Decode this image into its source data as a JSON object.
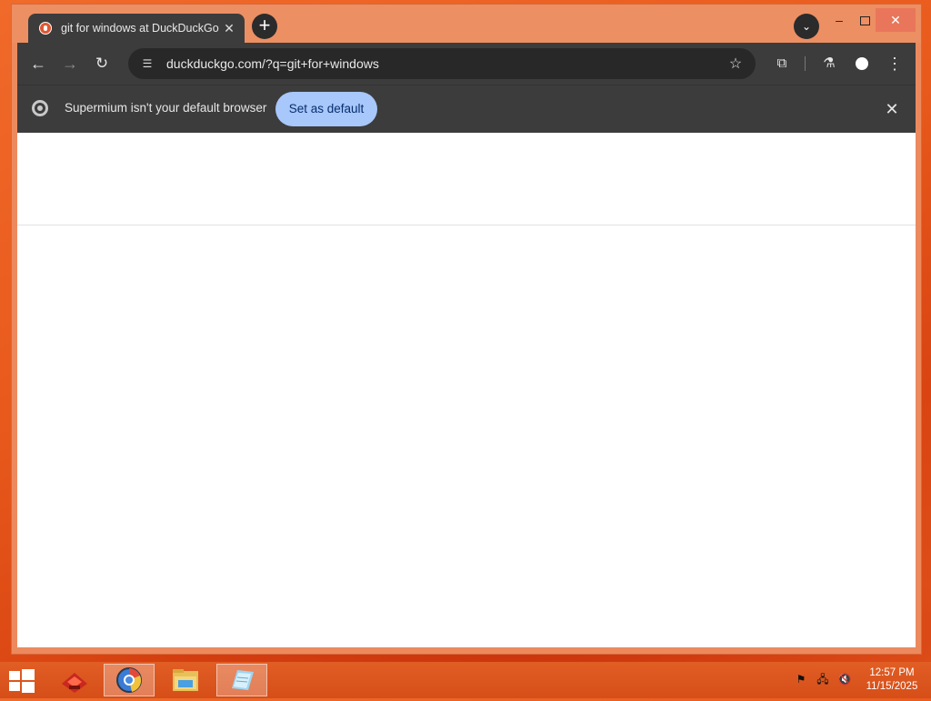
{
  "browser": {
    "tab": {
      "title": "git for windows at DuckDuckGo",
      "favicon": "duckduckgo-icon",
      "close": "✕"
    },
    "new_tab": "+",
    "window_controls": {
      "minimize": "–",
      "close": "✕"
    },
    "toolbar": {
      "url": "duckduckgo.com/?q=git+for+windows"
    },
    "infobar": {
      "message": "Supermium isn't your default browser",
      "button": "Set as default",
      "close": "✕"
    }
  },
  "taskbar": {
    "apps": [
      "xampp-icon",
      "supermium-browser-icon",
      "file-explorer-icon",
      "notepad-icon"
    ],
    "clock": {
      "time": "12:57 PM",
      "date": "11/15/2025"
    }
  },
  "colors": {
    "accent_button": "#a8c7fa",
    "toolbar": "#3c3c3c",
    "desktop": "#e85a1c"
  }
}
